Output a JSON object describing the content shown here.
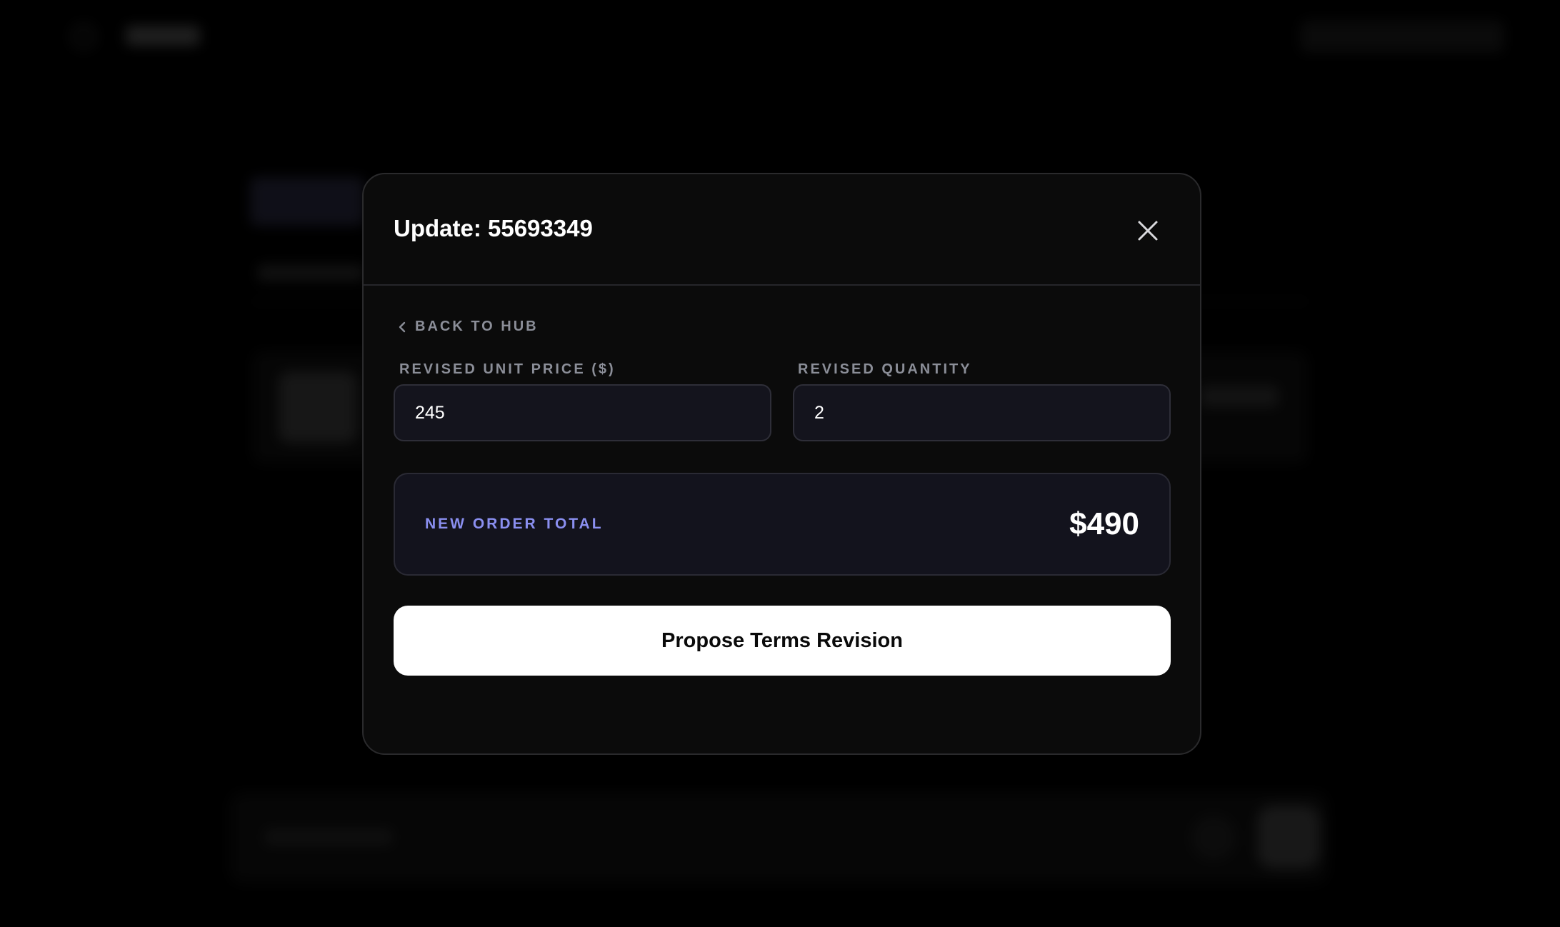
{
  "modal": {
    "title": "Update: 55693349",
    "back_label": "BACK TO HUB",
    "unit_price": {
      "label": "REVISED UNIT PRICE ($)",
      "value": "245"
    },
    "quantity": {
      "label": "REVISED QUANTITY",
      "value": "2"
    },
    "total": {
      "label": "NEW ORDER TOTAL",
      "value": "$490"
    },
    "submit_label": "Propose Terms Revision"
  },
  "icons": {
    "close": "close-icon",
    "back": "chevron-left-icon"
  },
  "colors": {
    "background": "#000000",
    "modal": "#0b0b0b",
    "accent_label": "#8a8ff0",
    "muted_label": "#8b8e98",
    "button": "#ffffff"
  }
}
